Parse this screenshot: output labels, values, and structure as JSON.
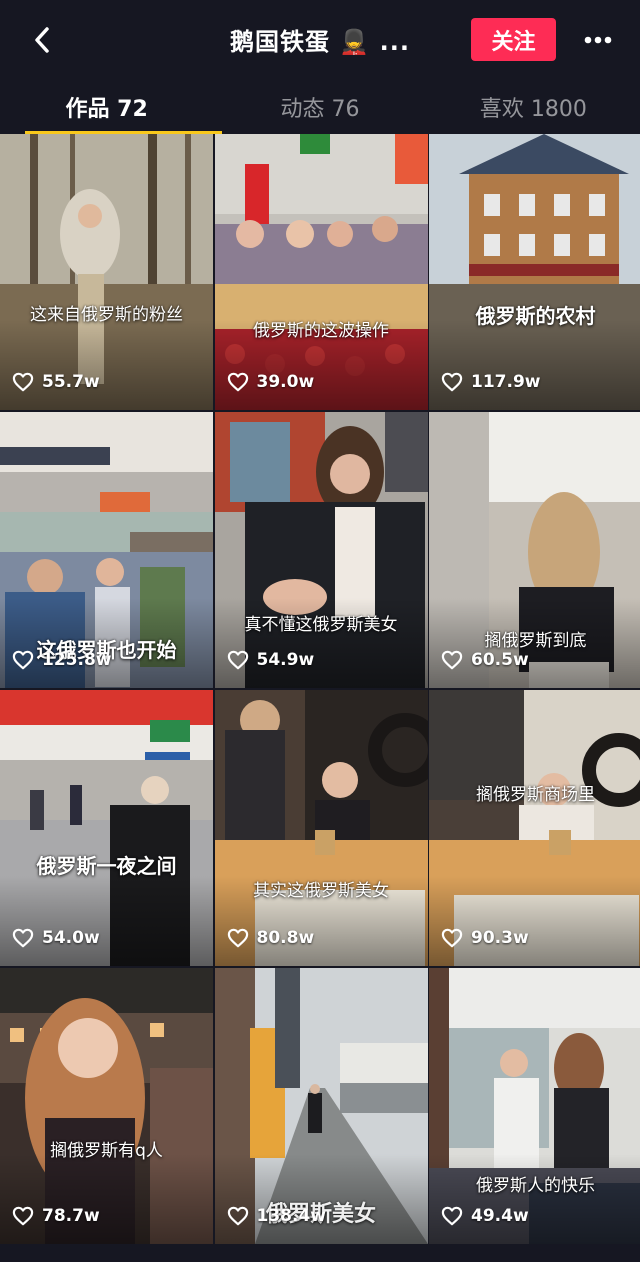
{
  "header": {
    "title": "鹅国铁蛋 💂 ...",
    "follow_label": "关注"
  },
  "tabs": [
    {
      "label": "作品 72",
      "active": true
    },
    {
      "label": "动态 76",
      "active": false
    },
    {
      "label": "喜欢 1800",
      "active": false
    }
  ],
  "videos": [
    {
      "caption": "这来自俄罗斯的粉丝",
      "likes": "55.7w"
    },
    {
      "caption": "俄罗斯的这波操作",
      "likes": "39.0w"
    },
    {
      "caption": "俄罗斯的农村",
      "likes": "117.9w"
    },
    {
      "caption": "这俄罗斯也开始",
      "likes": "125.8w"
    },
    {
      "caption": "真不懂这俄罗斯美女",
      "likes": "54.9w"
    },
    {
      "caption": "搁俄罗斯到底",
      "likes": "60.5w"
    },
    {
      "caption": "俄罗斯一夜之间",
      "likes": "54.0w"
    },
    {
      "caption": "其实这俄罗斯美女",
      "likes": "80.8w"
    },
    {
      "caption": "搁俄罗斯商场里",
      "likes": "90.3w"
    },
    {
      "caption": "搁俄罗斯有q人",
      "likes": "78.7w"
    },
    {
      "caption": "俄罗斯美女",
      "likes": "138.4w"
    },
    {
      "caption": "俄罗斯人的快乐",
      "likes": "49.4w"
    }
  ],
  "icons": {
    "back": "chevron-left-icon",
    "more": "more-dots-icon",
    "likes": "heart-outline-icon"
  },
  "colors": {
    "background": "#161722",
    "follow_button": "#fe2c55",
    "tab_indicator": "#f9c81b"
  }
}
